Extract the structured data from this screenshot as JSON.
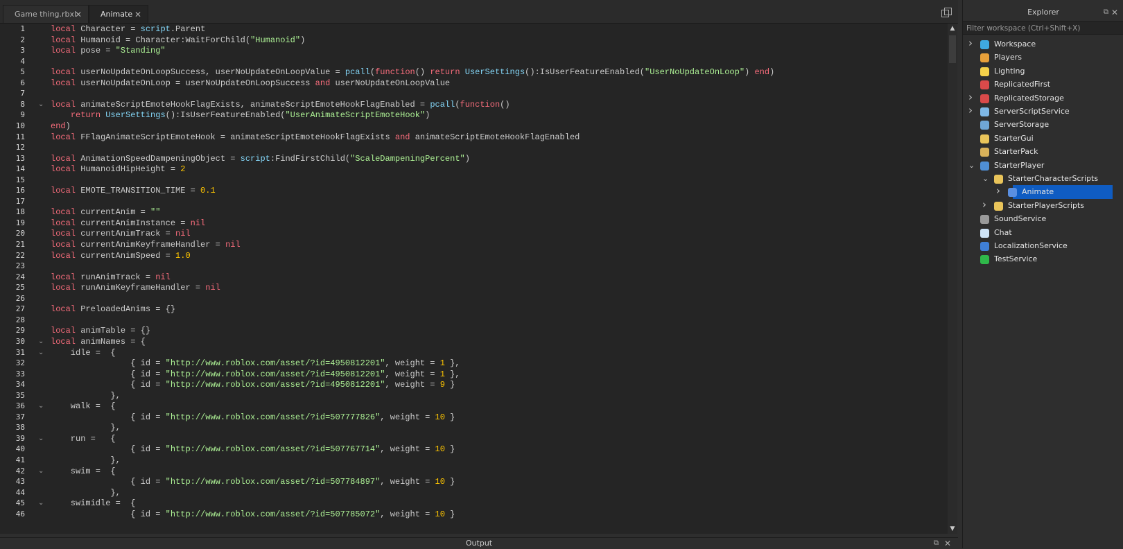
{
  "tabs": [
    {
      "label": "Game thing.rbxl",
      "active": false
    },
    {
      "label": "Animate",
      "active": true
    }
  ],
  "explorer": {
    "title": "Explorer",
    "filter_placeholder": "Filter workspace (Ctrl+Shift+X)",
    "items": [
      {
        "label": "Workspace",
        "depth": 0,
        "chevron": "right",
        "icon": "globe-icon",
        "color": "#3fa9e0"
      },
      {
        "label": "Players",
        "depth": 0,
        "chevron": "",
        "icon": "players-icon",
        "color": "#e8a03a"
      },
      {
        "label": "Lighting",
        "depth": 0,
        "chevron": "",
        "icon": "bulb-icon",
        "color": "#f5d14a"
      },
      {
        "label": "ReplicatedFirst",
        "depth": 0,
        "chevron": "",
        "icon": "replicated-first-icon",
        "color": "#d94a4a"
      },
      {
        "label": "ReplicatedStorage",
        "depth": 0,
        "chevron": "right",
        "icon": "replicated-storage-icon",
        "color": "#d94a4a"
      },
      {
        "label": "ServerScriptService",
        "depth": 0,
        "chevron": "right",
        "icon": "server-script-icon",
        "color": "#7fb8e6"
      },
      {
        "label": "ServerStorage",
        "depth": 0,
        "chevron": "",
        "icon": "server-storage-icon",
        "color": "#6fa6d6"
      },
      {
        "label": "StarterGui",
        "depth": 0,
        "chevron": "",
        "icon": "starter-gui-icon",
        "color": "#e9c45a"
      },
      {
        "label": "StarterPack",
        "depth": 0,
        "chevron": "",
        "icon": "starter-pack-icon",
        "color": "#d9b25a"
      },
      {
        "label": "StarterPlayer",
        "depth": 0,
        "chevron": "down",
        "icon": "starter-player-icon",
        "color": "#4f8fd6"
      },
      {
        "label": "StarterCharacterScripts",
        "depth": 1,
        "chevron": "down",
        "icon": "folder-icon",
        "color": "#e9c45a"
      },
      {
        "label": "Animate",
        "depth": 2,
        "chevron": "right",
        "icon": "local-script-icon",
        "color": "#5a8fe0",
        "selected": true
      },
      {
        "label": "StarterPlayerScripts",
        "depth": 1,
        "chevron": "right",
        "icon": "folder-icon",
        "color": "#e9c45a"
      },
      {
        "label": "SoundService",
        "depth": 0,
        "chevron": "",
        "icon": "speaker-icon",
        "color": "#9a9a9a"
      },
      {
        "label": "Chat",
        "depth": 0,
        "chevron": "",
        "icon": "chat-icon",
        "color": "#cfe4f7"
      },
      {
        "label": "LocalizationService",
        "depth": 0,
        "chevron": "",
        "icon": "globe-locale-icon",
        "color": "#3f7fd6"
      },
      {
        "label": "TestService",
        "depth": 0,
        "chevron": "",
        "icon": "check-icon",
        "color": "#2fb84a"
      }
    ]
  },
  "output": {
    "label": "Output"
  },
  "code": {
    "lines": [
      [
        [
          "kw",
          "local"
        ],
        [
          "p",
          " Character = "
        ],
        [
          "bi",
          "script"
        ],
        [
          "p",
          ".Parent"
        ]
      ],
      [
        [
          "kw",
          "local"
        ],
        [
          "p",
          " Humanoid = Character:WaitForChild("
        ],
        [
          "str",
          "\"Humanoid\""
        ],
        [
          "p",
          ")"
        ]
      ],
      [
        [
          "kw",
          "local"
        ],
        [
          "p",
          " pose = "
        ],
        [
          "str",
          "\"Standing\""
        ]
      ],
      [],
      [
        [
          "kw",
          "local"
        ],
        [
          "p",
          " userNoUpdateOnLoopSuccess, userNoUpdateOnLoopValue = "
        ],
        [
          "bi",
          "pcall"
        ],
        [
          "p",
          "("
        ],
        [
          "kw",
          "function"
        ],
        [
          "p",
          "() "
        ],
        [
          "kw",
          "return"
        ],
        [
          "p",
          " "
        ],
        [
          "bi",
          "UserSettings"
        ],
        [
          "p",
          "():IsUserFeatureEnabled("
        ],
        [
          "str",
          "\"UserNoUpdateOnLoop\""
        ],
        [
          "p",
          ") "
        ],
        [
          "kw",
          "end"
        ],
        [
          "p",
          ")"
        ]
      ],
      [
        [
          "kw",
          "local"
        ],
        [
          "p",
          " userNoUpdateOnLoop = userNoUpdateOnLoopSuccess "
        ],
        [
          "kw",
          "and"
        ],
        [
          "p",
          " userNoUpdateOnLoopValue"
        ]
      ],
      [],
      [
        [
          "kw",
          "local"
        ],
        [
          "p",
          " animateScriptEmoteHookFlagExists, animateScriptEmoteHookFlagEnabled = "
        ],
        [
          "bi",
          "pcall"
        ],
        [
          "p",
          "("
        ],
        [
          "kw",
          "function"
        ],
        [
          "p",
          "()"
        ]
      ],
      [
        [
          "p",
          "    "
        ],
        [
          "kw",
          "return"
        ],
        [
          "p",
          " "
        ],
        [
          "bi",
          "UserSettings"
        ],
        [
          "p",
          "():IsUserFeatureEnabled("
        ],
        [
          "str",
          "\"UserAnimateScriptEmoteHook\""
        ],
        [
          "p",
          ")"
        ]
      ],
      [
        [
          "kw",
          "end"
        ],
        [
          "p",
          ")"
        ]
      ],
      [
        [
          "kw",
          "local"
        ],
        [
          "p",
          " FFlagAnimateScriptEmoteHook = animateScriptEmoteHookFlagExists "
        ],
        [
          "kw",
          "and"
        ],
        [
          "p",
          " animateScriptEmoteHookFlagEnabled"
        ]
      ],
      [],
      [
        [
          "kw",
          "local"
        ],
        [
          "p",
          " AnimationSpeedDampeningObject = "
        ],
        [
          "bi",
          "script"
        ],
        [
          "p",
          ":FindFirstChild("
        ],
        [
          "str",
          "\"ScaleDampeningPercent\""
        ],
        [
          "p",
          ")"
        ]
      ],
      [
        [
          "kw",
          "local"
        ],
        [
          "p",
          " HumanoidHipHeight = "
        ],
        [
          "num",
          "2"
        ]
      ],
      [],
      [
        [
          "kw",
          "local"
        ],
        [
          "p",
          " EMOTE_TRANSITION_TIME = "
        ],
        [
          "num",
          "0.1"
        ]
      ],
      [],
      [
        [
          "kw",
          "local"
        ],
        [
          "p",
          " currentAnim = "
        ],
        [
          "str",
          "\"\""
        ]
      ],
      [
        [
          "kw",
          "local"
        ],
        [
          "p",
          " currentAnimInstance = "
        ],
        [
          "kw",
          "nil"
        ]
      ],
      [
        [
          "kw",
          "local"
        ],
        [
          "p",
          " currentAnimTrack = "
        ],
        [
          "kw",
          "nil"
        ]
      ],
      [
        [
          "kw",
          "local"
        ],
        [
          "p",
          " currentAnimKeyframeHandler = "
        ],
        [
          "kw",
          "nil"
        ]
      ],
      [
        [
          "kw",
          "local"
        ],
        [
          "p",
          " currentAnimSpeed = "
        ],
        [
          "num",
          "1.0"
        ]
      ],
      [],
      [
        [
          "kw",
          "local"
        ],
        [
          "p",
          " runAnimTrack = "
        ],
        [
          "kw",
          "nil"
        ]
      ],
      [
        [
          "kw",
          "local"
        ],
        [
          "p",
          " runAnimKeyframeHandler = "
        ],
        [
          "kw",
          "nil"
        ]
      ],
      [],
      [
        [
          "kw",
          "local"
        ],
        [
          "p",
          " PreloadedAnims = {}"
        ]
      ],
      [],
      [
        [
          "kw",
          "local"
        ],
        [
          "p",
          " animTable = {}"
        ]
      ],
      [
        [
          "kw",
          "local"
        ],
        [
          "p",
          " animNames = {"
        ]
      ],
      [
        [
          "p",
          "    idle =  {"
        ]
      ],
      [
        [
          "p",
          "                { id = "
        ],
        [
          "str",
          "\"http://www.roblox.com/asset/?id=4950812201\""
        ],
        [
          "p",
          ", weight = "
        ],
        [
          "num",
          "1"
        ],
        [
          "p",
          " },"
        ]
      ],
      [
        [
          "p",
          "                { id = "
        ],
        [
          "str",
          "\"http://www.roblox.com/asset/?id=4950812201\""
        ],
        [
          "p",
          ", weight = "
        ],
        [
          "num",
          "1"
        ],
        [
          "p",
          " },"
        ]
      ],
      [
        [
          "p",
          "                { id = "
        ],
        [
          "str",
          "\"http://www.roblox.com/asset/?id=4950812201\""
        ],
        [
          "p",
          ", weight = "
        ],
        [
          "num",
          "9"
        ],
        [
          "p",
          " }"
        ]
      ],
      [
        [
          "p",
          "            },"
        ]
      ],
      [
        [
          "p",
          "    walk =  {"
        ]
      ],
      [
        [
          "p",
          "                { id = "
        ],
        [
          "str",
          "\"http://www.roblox.com/asset/?id=507777826\""
        ],
        [
          "p",
          ", weight = "
        ],
        [
          "num",
          "10"
        ],
        [
          "p",
          " }"
        ]
      ],
      [
        [
          "p",
          "            },"
        ]
      ],
      [
        [
          "p",
          "    run =   {"
        ]
      ],
      [
        [
          "p",
          "                { id = "
        ],
        [
          "str",
          "\"http://www.roblox.com/asset/?id=507767714\""
        ],
        [
          "p",
          ", weight = "
        ],
        [
          "num",
          "10"
        ],
        [
          "p",
          " }"
        ]
      ],
      [
        [
          "p",
          "            },"
        ]
      ],
      [
        [
          "p",
          "    swim =  {"
        ]
      ],
      [
        [
          "p",
          "                { id = "
        ],
        [
          "str",
          "\"http://www.roblox.com/asset/?id=507784897\""
        ],
        [
          "p",
          ", weight = "
        ],
        [
          "num",
          "10"
        ],
        [
          "p",
          " }"
        ]
      ],
      [
        [
          "p",
          "            },"
        ]
      ],
      [
        [
          "p",
          "    swimidle =  {"
        ]
      ],
      [
        [
          "p",
          "                { id = "
        ],
        [
          "str",
          "\"http://www.roblox.com/asset/?id=507785072\""
        ],
        [
          "p",
          ", weight = "
        ],
        [
          "num",
          "10"
        ],
        [
          "p",
          " }"
        ]
      ]
    ],
    "fold_lines": [
      8,
      30,
      31,
      36,
      39,
      42,
      45
    ]
  }
}
